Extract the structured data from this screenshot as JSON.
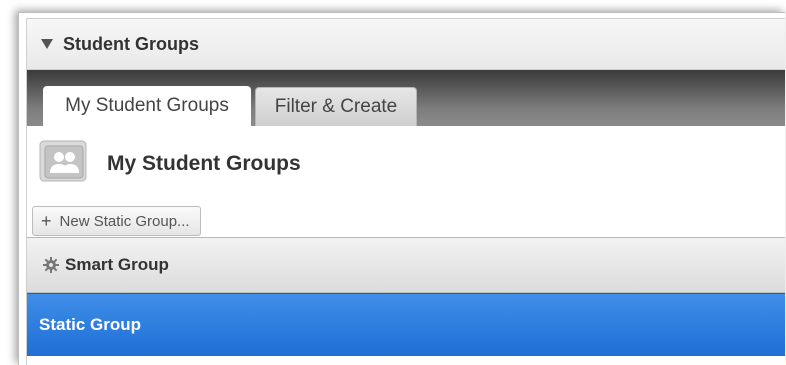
{
  "panel": {
    "title": "Student Groups"
  },
  "tabs": [
    {
      "label": "My Student Groups",
      "active": true
    },
    {
      "label": "Filter & Create",
      "active": false
    }
  ],
  "content": {
    "title": "My Student Groups",
    "new_group_button": {
      "icon": "plus-icon",
      "label": "New Static Group..."
    }
  },
  "groups": [
    {
      "label": "Smart Group",
      "icon": "gear-icon",
      "selected": false
    },
    {
      "label": "Static Group",
      "selected": true
    }
  ],
  "colors": {
    "selected_row": "#2a7ade",
    "tab_strip": "#5a5a5a"
  }
}
